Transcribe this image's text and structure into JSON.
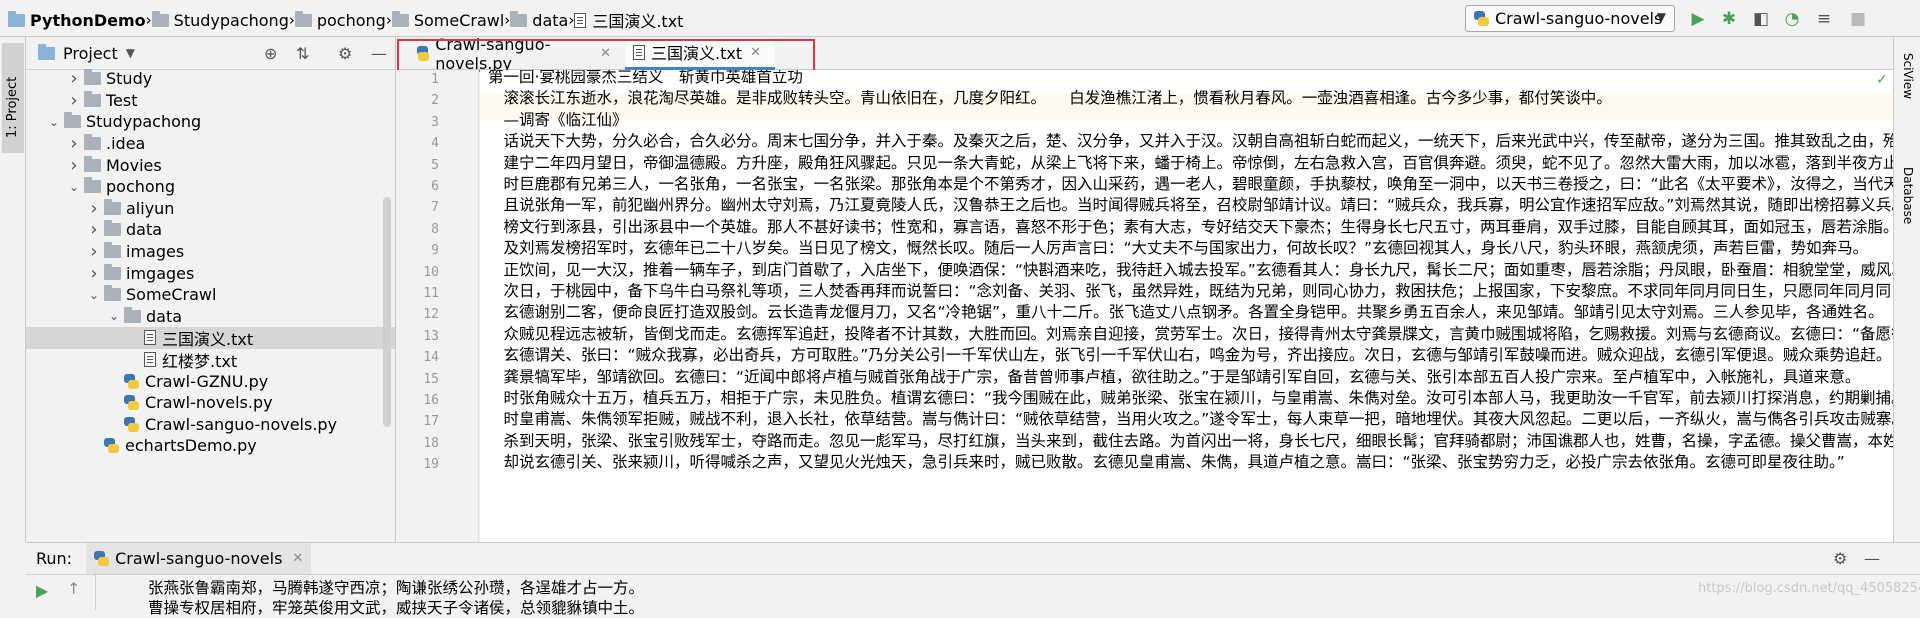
{
  "navbar": {
    "breadcrumbs": [
      "PythonDemo",
      "Studypachong",
      "pochong",
      "SomeCrawl",
      "data",
      "三国演义.txt"
    ],
    "run_config": "Crawl-sanguo-novels",
    "tools": [
      "run-icon",
      "debug-icon",
      "coverage-icon",
      "profile-icon",
      "concurrency-icon",
      "stop-icon"
    ]
  },
  "left_stripe": {
    "project_tab": "1: Project"
  },
  "right_stripe": {
    "sciview": "SciView",
    "database": "Database"
  },
  "project": {
    "title": "Project",
    "tree": [
      {
        "label": "Study",
        "depth": 2,
        "type": "folder",
        "expanded": false
      },
      {
        "label": "Test",
        "depth": 2,
        "type": "folder",
        "expanded": false
      },
      {
        "label": "Studypachong",
        "depth": 1,
        "type": "folder",
        "expanded": true
      },
      {
        "label": ".idea",
        "depth": 2,
        "type": "folder",
        "expanded": false
      },
      {
        "label": "Movies",
        "depth": 2,
        "type": "folder",
        "expanded": false
      },
      {
        "label": "pochong",
        "depth": 2,
        "type": "folder",
        "expanded": true
      },
      {
        "label": "aliyun",
        "depth": 3,
        "type": "folder",
        "expanded": false
      },
      {
        "label": "data",
        "depth": 3,
        "type": "folder",
        "expanded": false
      },
      {
        "label": "images",
        "depth": 3,
        "type": "folder",
        "expanded": false
      },
      {
        "label": "imgages",
        "depth": 3,
        "type": "folder",
        "expanded": false
      },
      {
        "label": "SomeCrawl",
        "depth": 3,
        "type": "folder",
        "expanded": true
      },
      {
        "label": "data",
        "depth": 4,
        "type": "folder",
        "expanded": true
      },
      {
        "label": "三国演义.txt",
        "depth": 5,
        "type": "txt",
        "selected": true
      },
      {
        "label": "红楼梦.txt",
        "depth": 5,
        "type": "txt"
      },
      {
        "label": "Crawl-GZNU.py",
        "depth": 4,
        "type": "py"
      },
      {
        "label": "Crawl-novels.py",
        "depth": 4,
        "type": "py"
      },
      {
        "label": "Crawl-sanguo-novels.py",
        "depth": 4,
        "type": "py"
      },
      {
        "label": "echartsDemo.py",
        "depth": 3,
        "type": "py"
      }
    ]
  },
  "editor": {
    "tabs": [
      {
        "label": "Crawl-sanguo-novels.py",
        "type": "py",
        "active": false
      },
      {
        "label": "三国演义.txt",
        "type": "txt",
        "active": true
      }
    ],
    "lines": [
      "第一回·宴桃园豪杰三结义　斩黄巾英雄首立功",
      "　滚滚长江东逝水，浪花淘尽英雄。是非成败转头空。青山依旧在，几度夕阳红。　　白发渔樵江渚上，惯看秋月春风。一壶浊酒喜相逢。古今多少事，都付笑谈中。",
      "　—调寄《临江仙》",
      "　话说天下大势，分久必合，合久必分。周末七国分争，并入于秦。及秦灭之后，楚、汉分争，又并入于汉。汉朝自高祖斩白蛇而起义，一统天下，后来光武中兴，传至献帝，遂分为三国。推其致乱之由，殆始于桓、灵二帝。",
      "　建宁二年四月望日，帝御温德殿。方升座，殿角狂风骤起。只见一条大青蛇，从梁上飞将下来，蟠于椅上。帝惊倒，左右急救入宫，百官俱奔避。须臾，蛇不见了。忽然大雷大雨，加以冰雹，落到半夜方止，坏却房屋无数。",
      "　时巨鹿郡有兄弟三人，一名张角，一名张宝，一名张梁。那张角本是个不第秀才，因入山采药，遇一老人，碧眼童颜，手执藜杖，唤角至一洞中，以天书三卷授之，曰：“此名《太平要术》，汝得之，当代天宣化，普救世人。”",
      "　且说张角一军，前犯幽州界分。幽州太守刘焉，乃江夏竟陵人氏，汉鲁恭王之后也。当时闻得贼兵将至，召校尉邹靖计议。靖曰：“贼兵众，我兵寡，明公宜作速招军应敌。”刘焉然其说，随即出榜招募义兵。",
      "　榜文行到涿县，引出涿县中一个英雄。那人不甚好读书；性宽和，寡言语，喜怒不形于色；素有大志，专好结交天下豪杰；生得身长七尺五寸，两耳垂肩，双手过膝，目能自顾其耳，面如冠玉，唇若涂脂。",
      "　及刘焉发榜招军时，玄德年已二十八岁矣。当日见了榜文，慨然长叹。随后一人厉声言曰：“大丈夫不与国家出力，何故长叹？”玄德回视其人，身长八尺，豹头环眼，燕颔虎须，声若巨雷，势如奔马。",
      "　正饮间，见一大汉，推着一辆车子，到店门首歇了，入店坐下，便唤酒保：“快斟酒来吃，我待赶入城去投军。”玄德看其人：身长九尺，髯长二尺；面如重枣，唇若涂脂；丹凤眼，卧蚕眉：相貌堂堂，威风凛凛。",
      "　次日，于桃园中，备下乌牛白马祭礼等项，三人焚香再拜而说誓曰：“念刘备、关羽、张飞，虽然异姓，既结为兄弟，则同心协力，救困扶危；上报国家，下安黎庶。不求同年同月同日生，只愿同年同月同日死。”",
      "　玄德谢别二客，便命良匠打造双股剑。云长造青龙偃月刀，又名“冷艳锯”，重八十二斤。张飞造丈八点钢矛。各置全身铠甲。共聚乡勇五百余人，来见邹靖。邹靖引见太守刘焉。三人参见毕，各通姓名。",
      "　众贼见程远志被斩，皆倒戈而走。玄德挥军追赶，投降者不计其数，大胜而回。刘焉亲自迎接，赏劳军士。次日，接得青州太守龚景牒文，言黄巾贼围城将陷，乞赐救援。刘焉与玄德商议。玄德曰：“备愿往救之。”",
      "　玄德谓关、张曰：“贼众我寡，必出奇兵，方可取胜。”乃分关公引一千军伏山左，张飞引一千军伏山右，鸣金为号，齐出接应。次日，玄德与邹靖引军鼓噪而进。贼众迎战，玄德引军便退。贼众乘势追赶。",
      "　龚景犒军毕，邹靖欲回。玄德曰：“近闻中郎将卢植与贼首张角战于广宗，备昔曾师事卢植，欲往助之。”于是邹靖引军自回，玄德与关、张引本部五百人投广宗来。至卢植军中，入帐施礼，具道来意。",
      "　时张角贼众十五万，植兵五万，相拒于广宗，未见胜负。植谓玄德曰：“我今围贼在此，贼弟张梁、张宝在颍川，与皇甫嵩、朱儁对垒。汝可引本部人马，我更助汝一千官军，前去颍川打探消息，约期剿捕。”",
      "　时皇甫嵩、朱儁领军拒贼，贼战不利，退入长社，依草结营。嵩与儁计曰：“贼依草结营，当用火攻之。”遂令军士，每人束草一把，暗地埋伏。其夜大风忽起。二更以后，一齐纵火，嵩与儁各引兵攻击贼寨。",
      "　杀到天明，张梁、张宝引败残军士，夺路而走。忽见一彪军马，尽打红旗，当头来到，截住去路。为首闪出一将，身长七尺，细眼长髯；官拜骑都尉；沛国谯郡人也，姓曹，名操，字孟德。操父曹嵩，本姓夏侯氏。",
      "　却说玄德引关、张来颍川，听得喊杀之声，又望见火光烛天，急引兵来时，贼已败散。玄德见皇甫嵩、朱儁，具道卢植之意。嵩曰：“张梁、张宝势穷力乏，必投广宗去依张角。玄德可即星夜往助。”"
    ]
  },
  "run": {
    "label": "Run:",
    "config": "Crawl-sanguo-novels",
    "output": [
      "张燕张鲁霸南郑，马腾韩遂守西凉；陶谦张绣公孙瓒，各逞雄才占一方。",
      "曹操专权居相府，牢笼英俊用文武，威挟天子令诸侯，总领貔貅镇中土。"
    ],
    "watermark": "https://blog.csdn.net/qq_45058254"
  }
}
